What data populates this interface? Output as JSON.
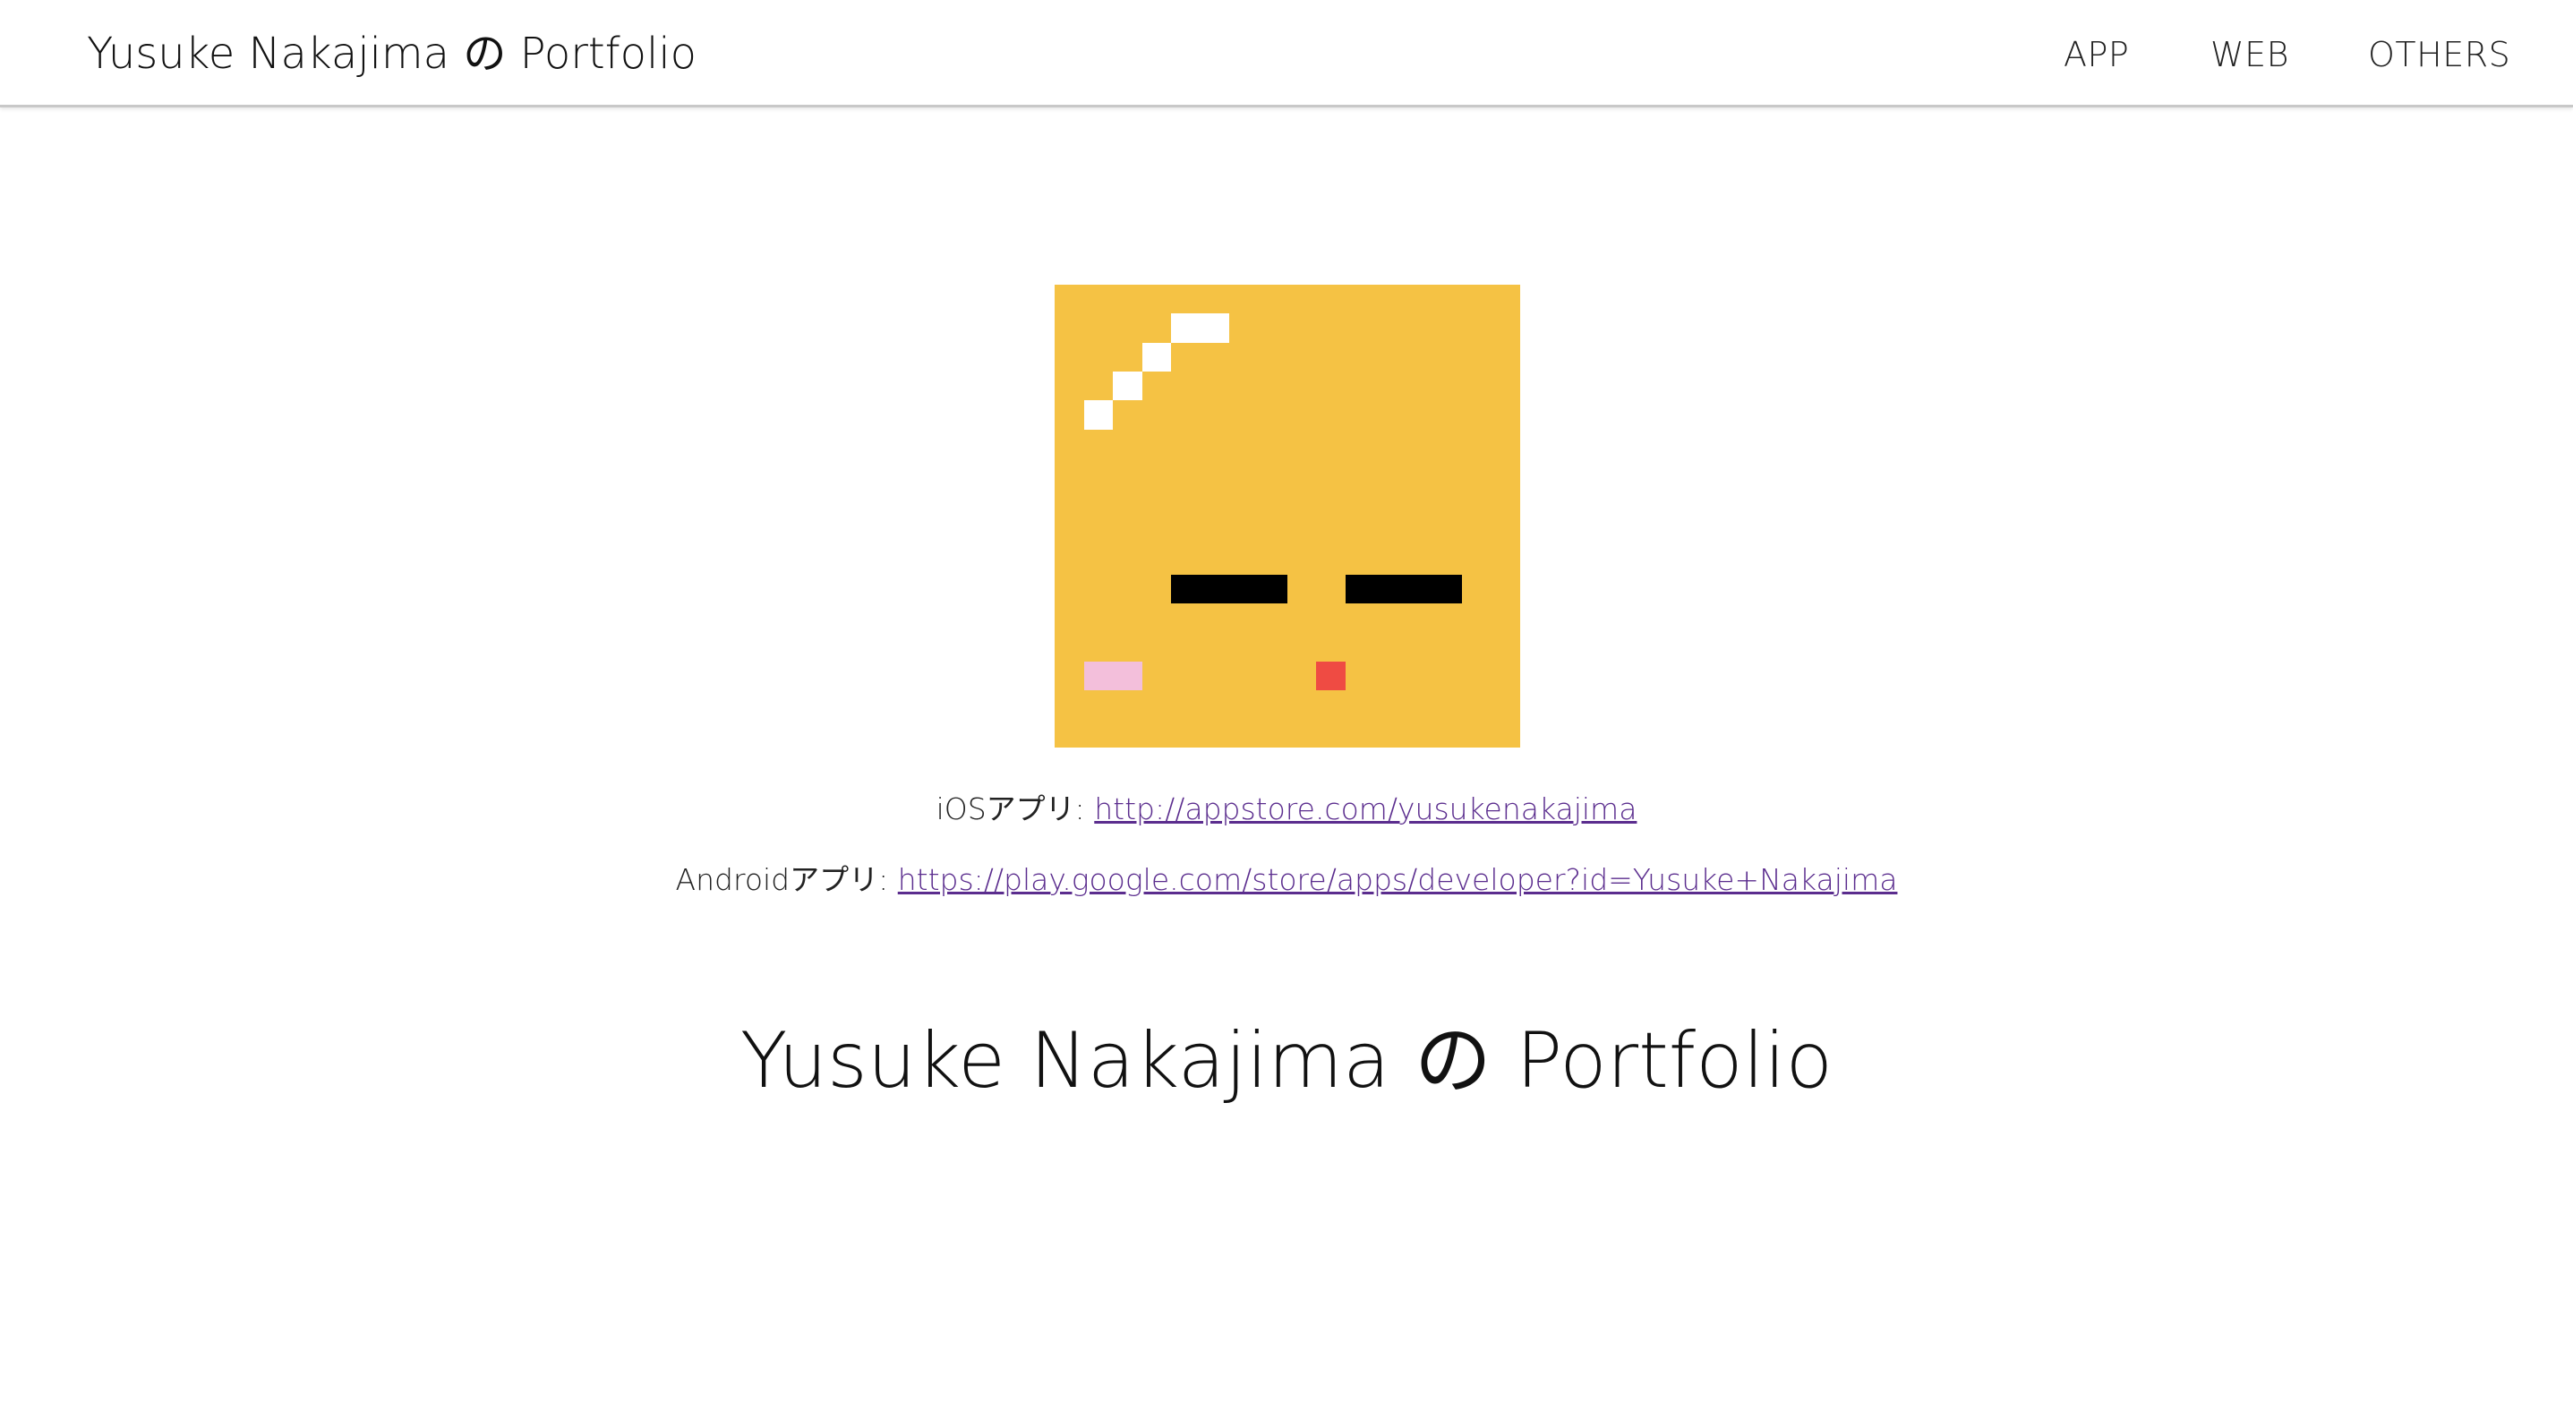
{
  "navbar": {
    "brand": "Yusuke Nakajima の Portfolio",
    "items": [
      {
        "label": "APP"
      },
      {
        "label": "WEB"
      },
      {
        "label": "OTHERS"
      }
    ]
  },
  "icon": {
    "name": "pixel-face-icon",
    "colors": {
      "background": "#f5c244",
      "highlight": "#ffffff",
      "eyes": "#000000",
      "cheek": "#f3bfdb",
      "mouth": "#ef4b43"
    }
  },
  "links": {
    "ios_label": "iOSアプリ: ",
    "ios_url": "http://appstore.com/yusukenakajima",
    "android_label": "Androidアプリ: ",
    "android_url": "https://play.google.com/store/apps/developer?id=Yusuke+Nakajima"
  },
  "main": {
    "title": "Yusuke Nakajima の Portfolio"
  },
  "theme": {
    "link_color": "#5b2d8e"
  }
}
